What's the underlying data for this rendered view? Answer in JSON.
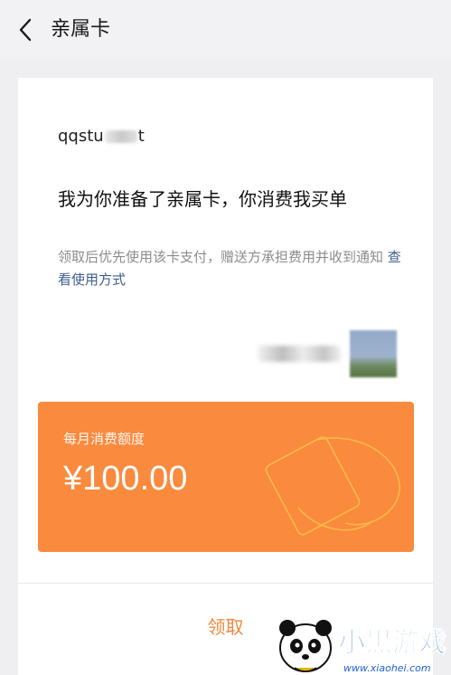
{
  "header": {
    "title": "亲属卡",
    "back_icon": "chevron-left-icon"
  },
  "card": {
    "sender_prefix": "qqstu",
    "sender_suffix": "t",
    "message": "我为你准备了亲属卡，你消费我买单",
    "description_text": "领取后优先使用该卡支付，赠送方承担费用并收到通知 ",
    "description_link": "查看使用方式"
  },
  "amount": {
    "label": "每月消费额度",
    "value": "¥100.00"
  },
  "action": {
    "claim_label": "领取"
  },
  "watermark": {
    "brand": "小黑游戏",
    "url": "www.xiaohei.com"
  },
  "colors": {
    "accent": "#fa8a3e",
    "claim_text": "#f0883f",
    "link": "#3d5f8f",
    "background": "#efeff2"
  }
}
